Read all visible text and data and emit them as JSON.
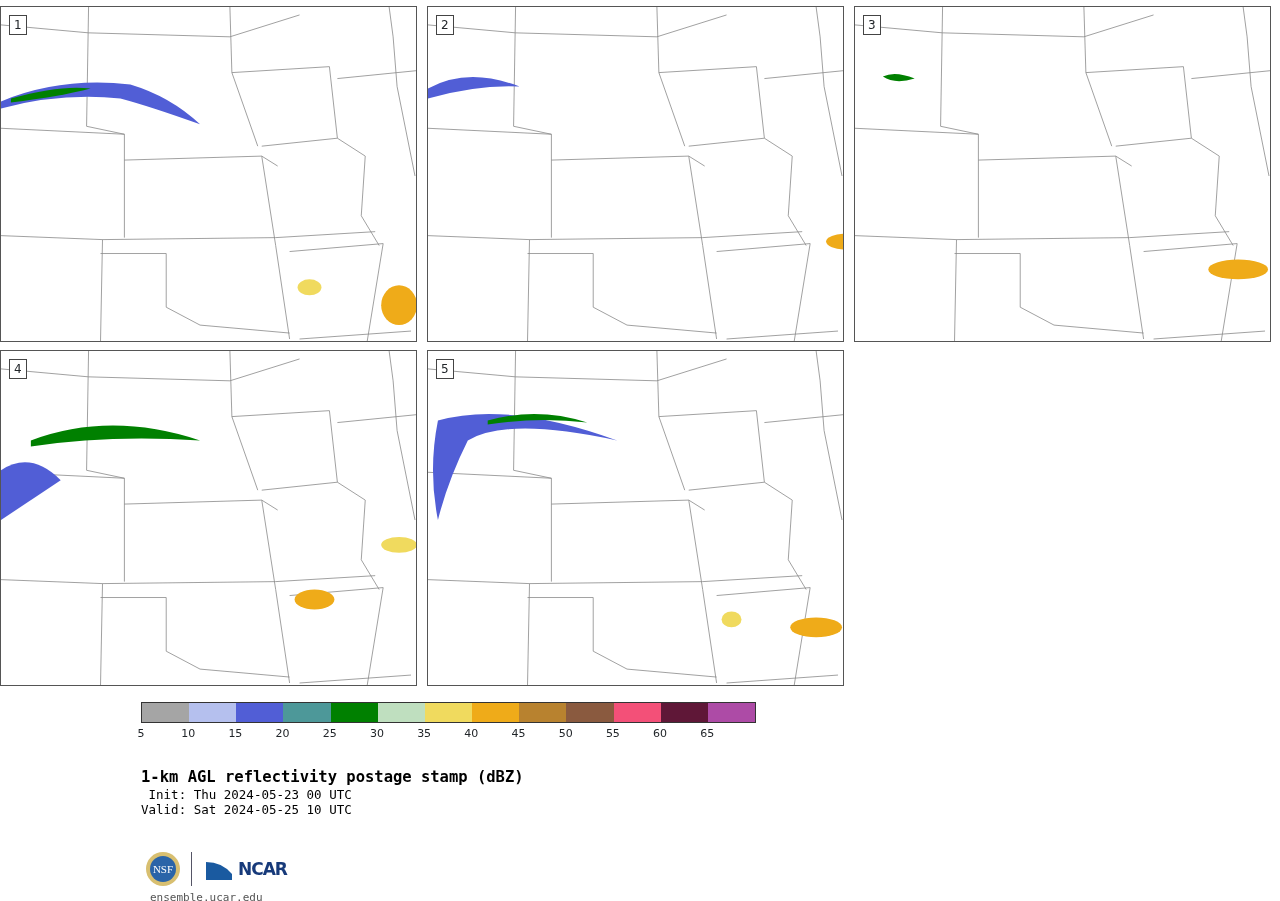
{
  "panels": [
    {
      "label": "1"
    },
    {
      "label": "2"
    },
    {
      "label": "3"
    },
    {
      "label": "4"
    },
    {
      "label": "5"
    }
  ],
  "colorbar": {
    "bins": [
      {
        "color": "#a5a5a5"
      },
      {
        "color": "#b5c0ee"
      },
      {
        "color": "#515ed6"
      },
      {
        "color": "#4d9899"
      },
      {
        "color": "#008000"
      },
      {
        "color": "#bfdfbf"
      },
      {
        "color": "#f0da5e"
      },
      {
        "color": "#efab19"
      },
      {
        "color": "#b8822f"
      },
      {
        "color": "#8a5a3f"
      },
      {
        "color": "#f35078"
      },
      {
        "color": "#5f1737"
      },
      {
        "color": "#ad4ba6"
      }
    ],
    "ticks": [
      "5",
      "10",
      "15",
      "20",
      "25",
      "30",
      "35",
      "40",
      "45",
      "50",
      "55",
      "60",
      "65"
    ]
  },
  "title": "1-km AGL reflectivity postage stamp (dBZ)",
  "init": " Init: Thu 2024-05-23 00 UTC",
  "valid": "Valid: Sat 2024-05-25 10 UTC",
  "logos": {
    "nsf": "NSF",
    "ncar": "NCAR"
  },
  "site": "ensemble.ucar.edu"
}
